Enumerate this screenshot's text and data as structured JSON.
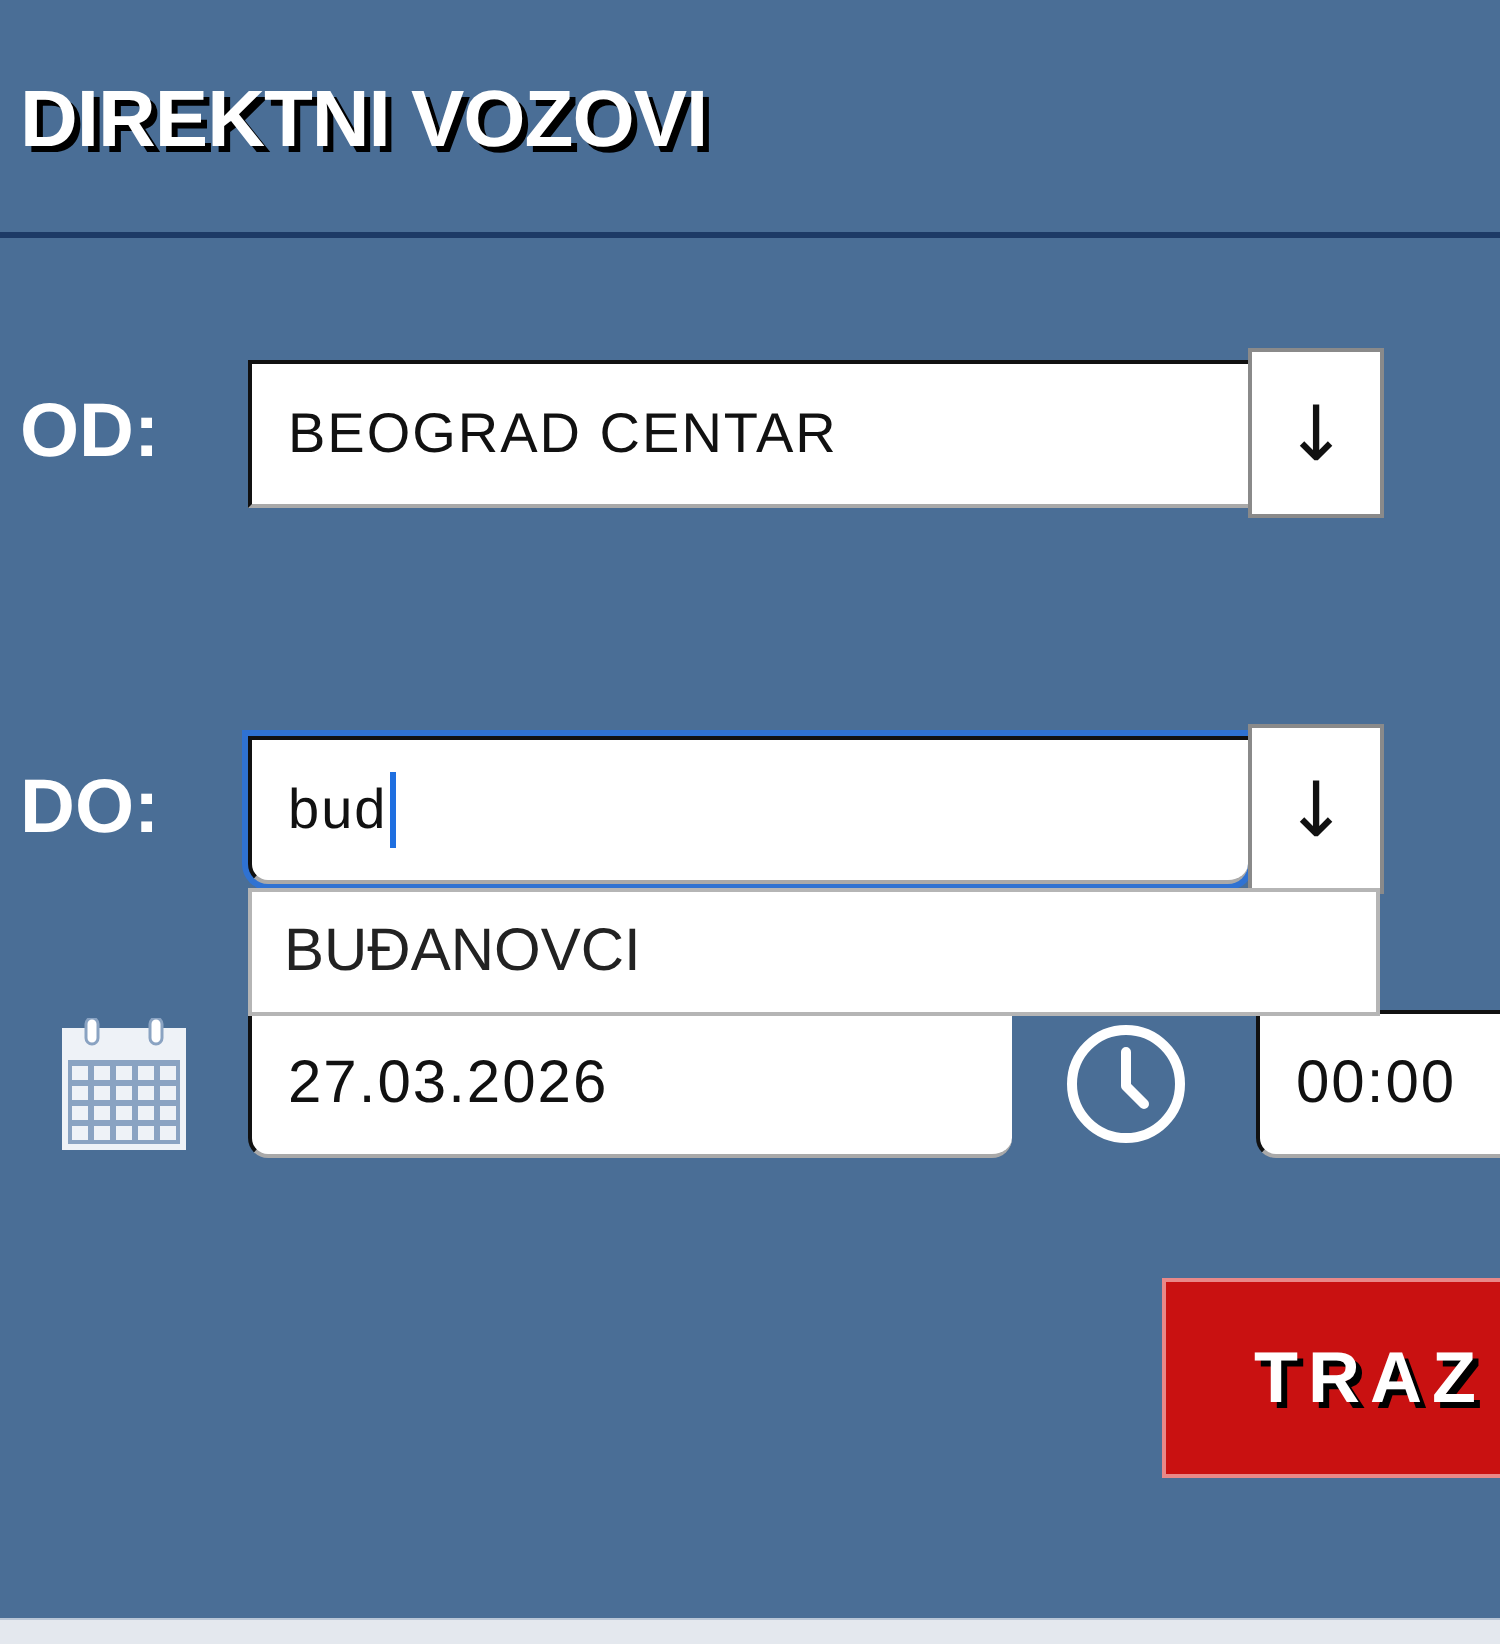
{
  "header": {
    "title": "DIREKTNI VOZOVI"
  },
  "from": {
    "label": "OD:",
    "value": "BEOGRAD CENTAR",
    "focused": false,
    "button": "↓"
  },
  "to": {
    "label": "DO:",
    "value": "bud",
    "focused": true,
    "button": "↓",
    "suggestions": [
      {
        "label": "BUĐANOVCI",
        "selected": false
      }
    ]
  },
  "date": {
    "value": "27.03.2026"
  },
  "time": {
    "value": "00:00"
  },
  "search_button": {
    "label": "TRAZ"
  }
}
